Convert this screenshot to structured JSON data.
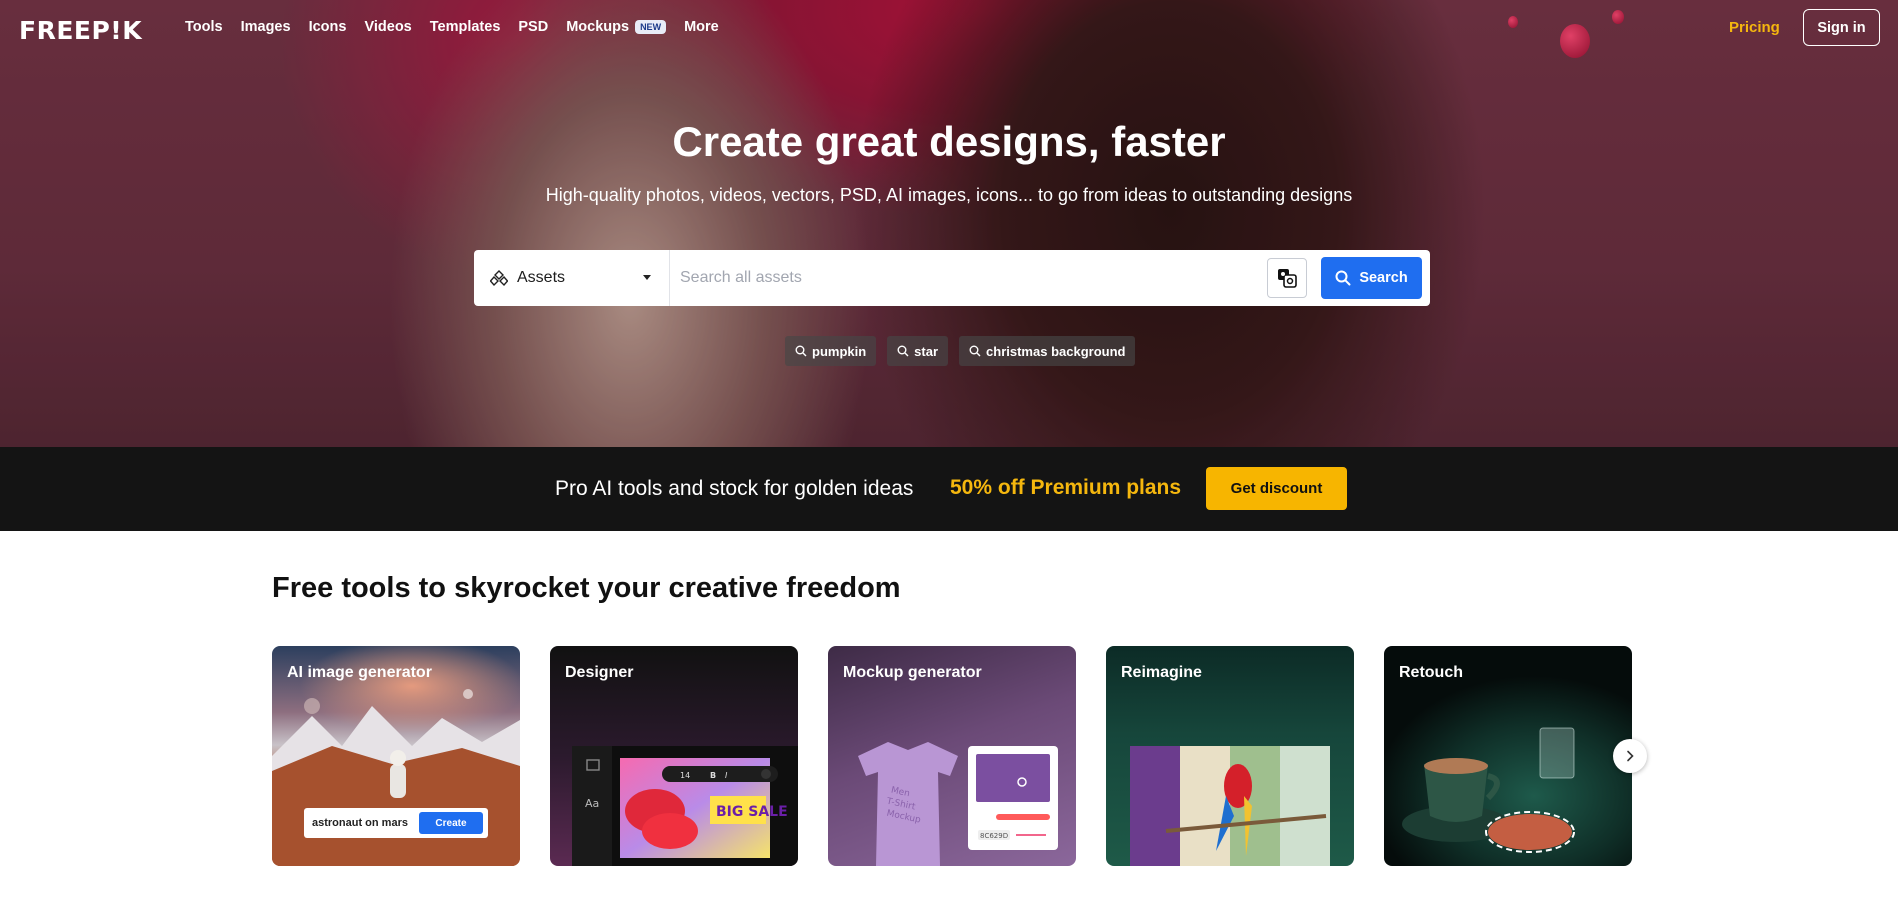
{
  "nav": {
    "logo": "FREEP!K",
    "links": [
      "Tools",
      "Images",
      "Icons",
      "Videos",
      "Templates",
      "PSD",
      "Mockups",
      "More"
    ],
    "mockups_badge": "NEW",
    "pricing": "Pricing",
    "signin": "Sign in"
  },
  "hero": {
    "title": "Create great designs, faster",
    "subtitle": "High-quality photos, videos, vectors, PSD, AI images, icons... to go from ideas to outstanding designs"
  },
  "search": {
    "category": "Assets",
    "placeholder": "Search all assets",
    "button": "Search",
    "tags": [
      "pumpkin",
      "star",
      "christmas background"
    ]
  },
  "promo": {
    "text": "Pro AI tools and stock for golden ideas",
    "highlight": "50% off Premium plans",
    "button": "Get discount"
  },
  "tools": {
    "title": "Free tools to skyrocket your creative freedom",
    "cards": [
      {
        "title": "AI image generator",
        "prompt": "astronaut on mars",
        "button": "Create"
      },
      {
        "title": "Designer",
        "font_size": "14",
        "sale_text": "BIG SALE"
      },
      {
        "title": "Mockup generator",
        "shirt_text": "Men T-Shirt Mockup",
        "hex": "8C629D"
      },
      {
        "title": "Reimagine"
      },
      {
        "title": "Retouch"
      }
    ]
  },
  "colors": {
    "accent": "#1f6ef0",
    "pricing": "#f5b70e",
    "promo_button": "#f7b500",
    "promo_bg": "#141414"
  }
}
